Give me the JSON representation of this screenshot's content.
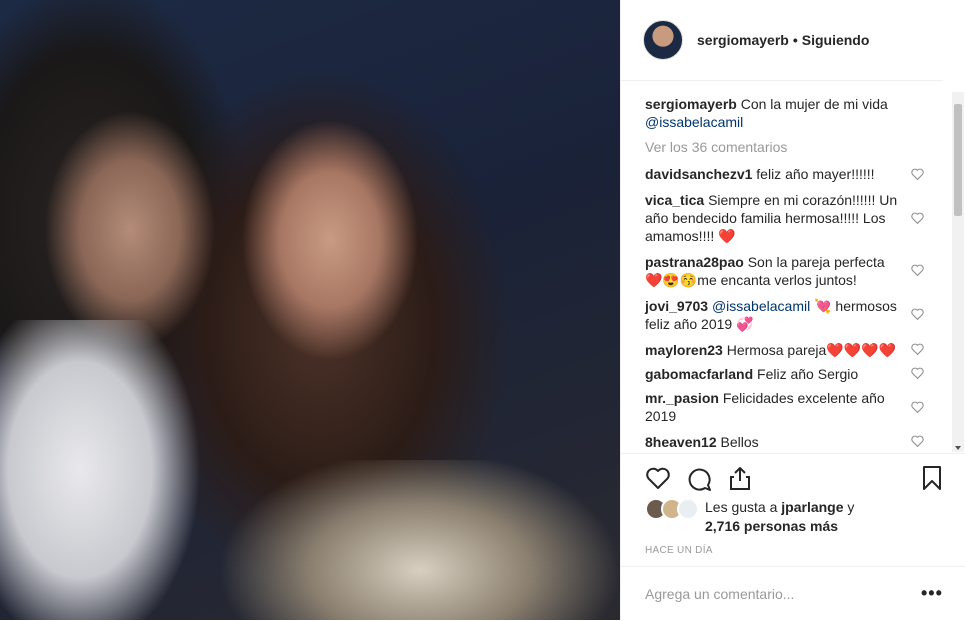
{
  "post": {
    "username": "sergiomayerb",
    "separator": "•",
    "follow_status": "Siguiendo",
    "caption_user": "sergiomayerb",
    "caption_text": "Con la mujer de mi vida",
    "caption_mention": "@issabelacamil",
    "view_all": "Ver los 36 comentarios"
  },
  "comments": [
    {
      "user": "davidsanchezv1",
      "text": "feliz año mayer!!!!!!"
    },
    {
      "user": "vica_tica",
      "text": "Siempre en mi corazón!!!!!! Un año bendecido familia hermosa!!!!! Los amamos!!!! ❤️"
    },
    {
      "user": "pastrana28pao",
      "text": "Son la pareja perfecta ❤️😍😚me encanta verlos juntos!"
    },
    {
      "user": "jovi_9703",
      "mention": "@issabelacamil",
      "text": "💘 hermosos feliz año 2019 💞"
    },
    {
      "user": "mayloren23",
      "text": "Hermosa pareja❤️❤️❤️❤️"
    },
    {
      "user": "gabomacfarland",
      "text": "Feliz año Sergio"
    },
    {
      "user": "mr._pasion",
      "text": "Felicidades excelente año 2019"
    },
    {
      "user": "8heaven12",
      "text": "Bellos"
    }
  ],
  "likes": {
    "prefix": "Les gusta a",
    "user": "jparlange",
    "suffix": "y",
    "count_text": "2,716 personas más"
  },
  "timestamp": "HACE UN DÍA",
  "add_comment": {
    "placeholder": "Agrega un comentario..."
  },
  "more_options": "•••",
  "icons": {
    "like": "heart-outline-icon",
    "comment": "speech-bubble-icon",
    "share": "share-upload-icon",
    "save": "bookmark-icon"
  },
  "colors": {
    "link": "#003569",
    "muted": "#999999",
    "text": "#262626",
    "divider": "#efefef"
  }
}
